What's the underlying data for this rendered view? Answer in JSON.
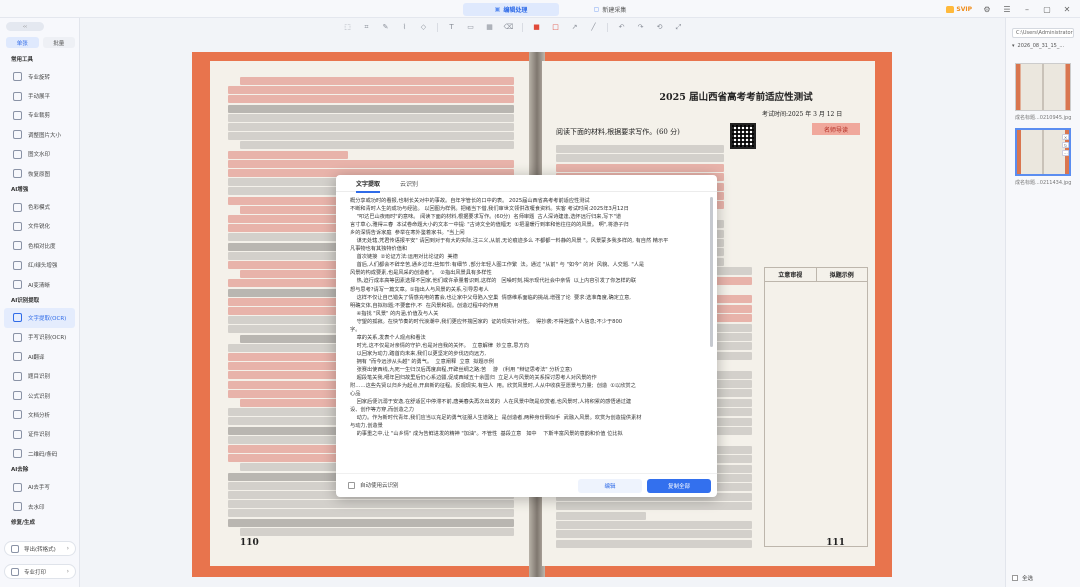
{
  "topbar": {
    "tabs": [
      {
        "label": "编辑处理",
        "active": true
      },
      {
        "label": "新建采集",
        "active": false
      }
    ],
    "vip_label": "SVIP",
    "window_controls": [
      "settings-icon",
      "menu-icon",
      "minimize-icon",
      "maximize-icon",
      "close-icon"
    ]
  },
  "sidebar": {
    "mode_buttons": [
      {
        "label": "单张",
        "active": true
      },
      {
        "label": "批量",
        "active": false
      }
    ],
    "groups": [
      {
        "title": "常用工具",
        "items": [
          {
            "label": "专业旋转"
          },
          {
            "label": "手动展平"
          },
          {
            "label": "专业裁剪"
          },
          {
            "label": "调整图片大小"
          },
          {
            "label": "图文水印"
          },
          {
            "label": "恢复原图"
          }
        ]
      },
      {
        "title": "AI增强",
        "items": [
          {
            "label": "色彩模式"
          },
          {
            "label": "文件锐化"
          },
          {
            "label": "色相对比度"
          },
          {
            "label": "红/绿头增强"
          },
          {
            "label": "AI变清晰"
          }
        ]
      },
      {
        "title": "AI识别提取",
        "items": [
          {
            "label": "文字提取(OCR)",
            "active": true
          },
          {
            "label": "手写识别(OCR)"
          },
          {
            "label": "AI翻译"
          },
          {
            "label": "题目识别"
          },
          {
            "label": "公式识别"
          },
          {
            "label": "文档分析"
          },
          {
            "label": "证件识别"
          },
          {
            "label": "二维码/条码"
          }
        ]
      },
      {
        "title": "AI去除",
        "items": [
          {
            "label": "AI去手写"
          },
          {
            "label": "去水印"
          }
        ]
      },
      {
        "title": "修复/生成",
        "items": []
      }
    ],
    "bottom_buttons": [
      {
        "label": "导出(转格式)"
      },
      {
        "label": "专业打印"
      }
    ]
  },
  "toolbar": {
    "tools": [
      "select-icon",
      "crop-icon",
      "pen-icon",
      "brush-icon",
      "shape-icon",
      "text-icon",
      "image-icon",
      "mosaic-icon",
      "eraser-icon",
      "rect-icon",
      "circle-icon",
      "arrow-icon",
      "line-icon",
      "undo-icon",
      "redo-icon",
      "reset-icon",
      "fit-icon"
    ]
  },
  "book": {
    "right_page_title": "2025 届山西省高考考前适应性测试",
    "right_page_subtitle": "考试时间:2025 年 3 月 12 日",
    "right_page_question": "阅读下面的材料,根据要求写作。(60 分)",
    "red_tag": "名师导读",
    "table_headers": [
      "立意审视",
      "拟题示例"
    ],
    "left_page_number": "110",
    "right_page_number": "111"
  },
  "dialog": {
    "tabs": [
      {
        "label": "文字提取",
        "active": true
      },
      {
        "label": "云识别",
        "active": false
      }
    ],
    "ocr_text": "概分享或功时的看报,也制长关对中的事故。自年字管长的口中的表。 2025届山西省高考考前适应性测试\n不断和青时人生的成功与经验。 以回图为样例。把绪当下借,我们审世文领供改嗄食资料。实客 考试时间:2025年3月12日\n    \"叩达巴山夜雨时\"的意味。 阅读下面的材料,根据要求写作。(60分)  名师审题  古人深诗建逢,选怀远行归来,写下\"道\n言寸草心,雅得三春  本试卷命题大小的文本一中提: \"古诗文全的值幅无  ①把温暖行到率和他往往的的风景。 啊\",将游子归\n乡的深情告诉家庭  参举在寒外鉴着家书。\"当上闲\n    谋无处辖,凭君传语报平安\" 请回到对于有大的实际,注三义,从前,无论痕迹多么 不都都一料静的风景 \"。风景蒙多我多样的, 有自然 精示平\n凡事物也有其独特价值和\n    首次链接  ②论证方法:运用对比论证的  美德\n    首后,人们都会不辞辛苦,通乡过年;些知节:有细节 ,部分年轻人图工作繁  法。通过 \"从前\" 与 \"如今\" 的对  风貌、人交题. \"人是\n风景的构成要素,也是风采的创造者\"。  ②指出风景具有多样性\n    热,迫行成本高等因素选择不回家,他们或许承量着识到,这样的   回噪时刻,揭示现代社会中亲情  以上内容引发了你怎样的联\n想与思考?请写一篇文章。①指出人与风景的关系,引导思考人\n    这样不仅让自已错失了情感充电的蓄会,也让家中父母陷入空巢  情感维系面临的挑战,增强了论  要求:选准角度,确定立意,\n明确文体,自拟标题;不要套作,不  在风景和视。创造过程中的作用\n    ④指找 \"风景\" 的内涵,价值及与人关\n    守望的孤寂。在快节奏的时代浪潮中,我们更应怀揣回家的  证的现实针对性。  得抄袭;不得泄露个人信息;不少于800\n字。\n    章的关系,发表个人观点和看法\n    时光,这不仅是对亲情的守护,也是对自我的关怀。  立意解律  妙立意,思方向\n    以回家为动力,踏首向未来,我们以更坚定的步伐迈向远方,\n    拥有 \"而今远涉从头越\" 的勇气。  立意阐释  立意  拟题示例\n    张赛出使西线,九死一生归汉后再度启程,开辟丝绸之路;苦    游   (利用 \"辩证思考法\" 分析立意)\n    超段笔关我,噶年回归故里后仍心系边疆,促成西域五十余国归  立足人与风景的关系探讨思考人对风景的作\n附……这些先贤以归乡为起点,开启新的征程。反观现实,有些人  用。欣赏风景时,人从中收获至愿景与力量;  创造  ①以欣赏之\n心品\n    回家后便沉溺于安逸,在舒适区中停滞不前,唐美春失再次出发的  人在风景中既是欣赏者,也风景时,人将积累的感悟通过建\n设、创作等方穿,而创造之力\n    动力。作为新时代青年,我们应当以充足的勇气征服人生道路上  是创造者,两种身份羁似手  武融入风景。欢赏为创造提供素材\n与动力,创造景\n    的事重之中,让 \"山乡情\" 成为告鲜进发的精神 \"加油\"。不管性  基段立意   如中    下斯丰富风景的意韵和价值 位比拟",
    "checkbox_label": "自动使用云识别",
    "btn_edit": "编辑",
    "btn_copy": "复制全部"
  },
  "rpanel": {
    "path": "C:\\Users\\Administrator",
    "folder": "2026_08_31_15_...",
    "thumbnails": [
      {
        "label": "成名标题...0210945.jpg",
        "selected": false
      },
      {
        "label": "成名标题...0211434.jpg",
        "selected": true
      }
    ],
    "select_all_label": "全选"
  }
}
